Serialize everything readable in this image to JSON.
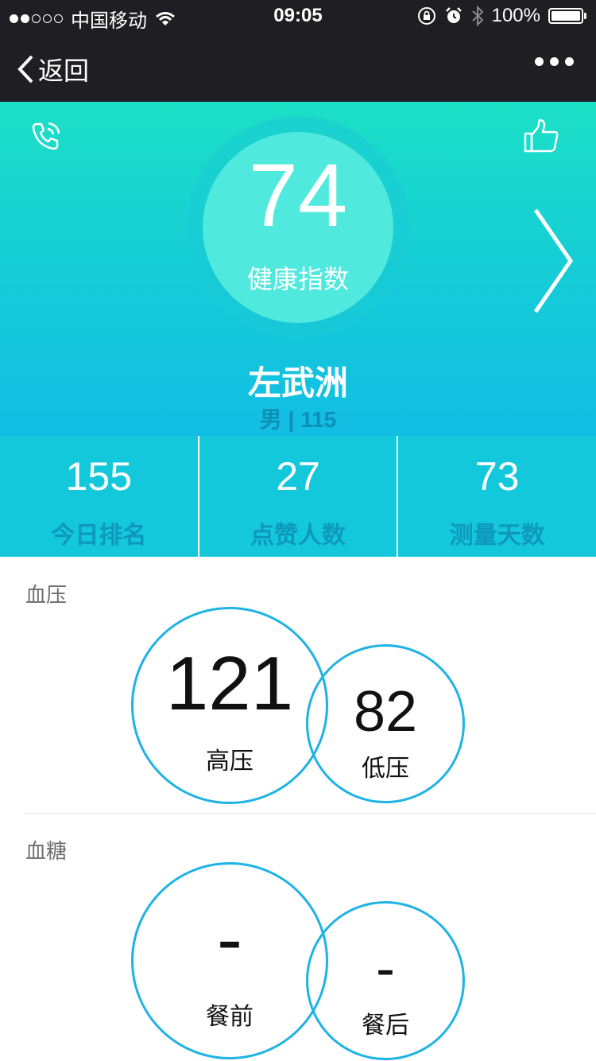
{
  "status_bar": {
    "carrier": "中国移动",
    "time": "09:05",
    "battery": "100%"
  },
  "nav": {
    "back_label": "返回"
  },
  "hero": {
    "score": "74",
    "score_label": "健康指数",
    "name": "左武洲",
    "info": "男 | 115"
  },
  "stats": [
    {
      "value": "155",
      "label": "今日排名"
    },
    {
      "value": "27",
      "label": "点赞人数"
    },
    {
      "value": "73",
      "label": "测量天数"
    }
  ],
  "blood_pressure": {
    "title": "血压",
    "high": {
      "value": "121",
      "label": "高压"
    },
    "low": {
      "value": "82",
      "label": "低压"
    }
  },
  "blood_sugar": {
    "title": "血糖",
    "before": {
      "value": "-",
      "label": "餐前"
    },
    "after": {
      "value": "-",
      "label": "餐后"
    }
  },
  "colors": {
    "accent": "#1eb3e4",
    "hero_top": "#1ce0c6",
    "hero_bottom": "#12bde3",
    "nav_bg": "#1f1e23"
  }
}
